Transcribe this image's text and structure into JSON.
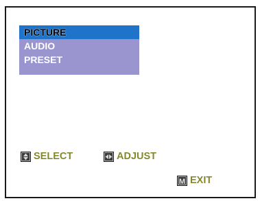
{
  "osd_menu": {
    "items": [
      {
        "label": "PICTURE",
        "selected": true
      },
      {
        "label": "AUDIO",
        "selected": false
      },
      {
        "label": "PRESET",
        "selected": false
      }
    ]
  },
  "hints": {
    "select": {
      "icon": "up-down-arrow-key-icon",
      "label": "SELECT"
    },
    "adjust": {
      "icon": "left-right-arrow-key-icon",
      "label": "ADJUST"
    },
    "exit": {
      "icon": "menu-key-icon",
      "key_glyph": "M",
      "label": "EXIT"
    }
  },
  "colors": {
    "menu_background": "#9a94cf",
    "selected_highlight": "#1f73c8",
    "hint_text": "#86882d",
    "border": "#1a1a1a"
  }
}
